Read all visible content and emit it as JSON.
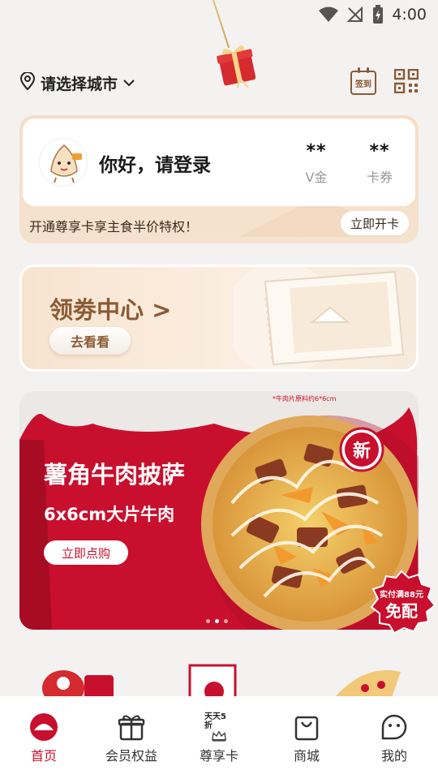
{
  "status_bar": {
    "time": "4:00",
    "icons": [
      "wifi-icon",
      "signal-off-icon",
      "battery-charging-icon"
    ]
  },
  "header": {
    "city_label": "请选择城市",
    "sign_in_label": "签到",
    "icons": [
      "location-pin-icon",
      "chevron-down-icon",
      "calendar-checkin-icon",
      "qr-code-icon"
    ]
  },
  "member_card": {
    "greeting": "你好，请登录",
    "stats": [
      {
        "value": "**",
        "label": "V金"
      },
      {
        "value": "**",
        "label": "卡券"
      }
    ],
    "promo_text": "开通尊享卡享主食半价特权！",
    "open_button_label": "立即开卡"
  },
  "coupon_center": {
    "title": "领劵中心 >",
    "button_label": "去看看"
  },
  "pizza_banner": {
    "title": "薯角牛肉披萨",
    "subtitle": "6x6cm大片牛肉",
    "button_label": "立即点购",
    "note": "*牛肉片原料约6*6cm",
    "badge_text": "新",
    "carousel_total": 3,
    "carousel_active": 2
  },
  "free_delivery_badge": {
    "line1": "实付满88元",
    "line2": "免配"
  },
  "bottom_nav": {
    "items": [
      {
        "label": "首页",
        "icon": "home-pizza-hut-icon",
        "active": true
      },
      {
        "label": "会员权益",
        "icon": "gift-box-icon",
        "active": false
      },
      {
        "label": "尊享卡",
        "icon": "crown-card-icon",
        "active": false,
        "top_text": "天天5折"
      },
      {
        "label": "商城",
        "icon": "shopping-bag-icon",
        "active": false
      },
      {
        "label": "我的",
        "icon": "profile-face-icon",
        "active": false
      }
    ]
  },
  "colors": {
    "brand_red": "#c8102e",
    "brand_brown": "#8b5a34",
    "background": "#f3f2f0"
  }
}
